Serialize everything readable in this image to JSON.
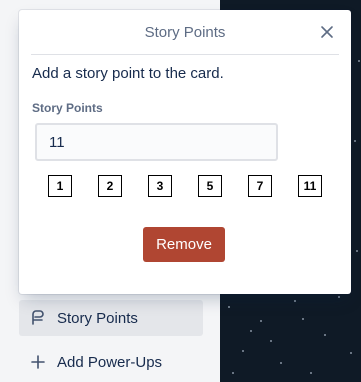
{
  "popover": {
    "title": "Story Points",
    "description": "Add a story point to the card.",
    "field_label": "Story Points",
    "input_value": "11",
    "point_options": [
      "1",
      "2",
      "3",
      "5",
      "7",
      "11"
    ],
    "remove_label": "Remove"
  },
  "sidebar": {
    "items": [
      {
        "label": "Story Points",
        "icon": "story-points-icon",
        "active": true
      },
      {
        "label": "Add Power-Ups",
        "icon": "plus-icon",
        "active": false
      }
    ]
  },
  "colors": {
    "remove_button": "#b04632",
    "background_dark": "#0f1a26"
  }
}
